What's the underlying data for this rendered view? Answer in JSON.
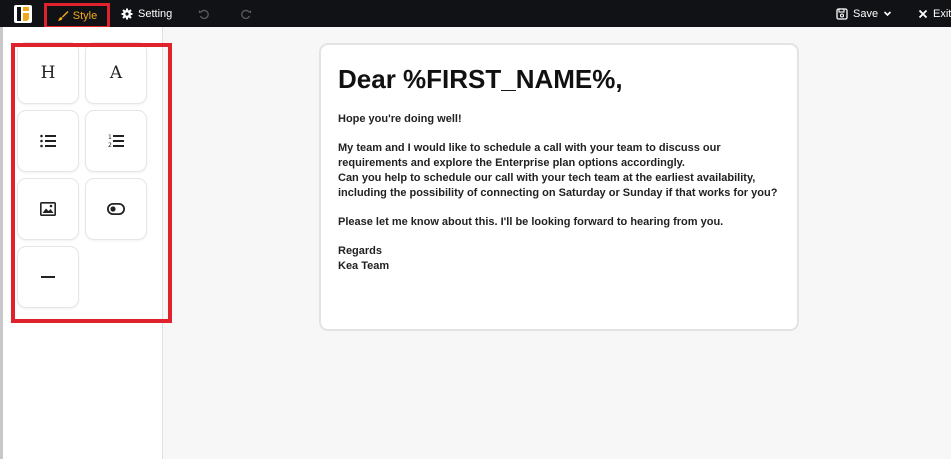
{
  "toolbar": {
    "style_label": "Style",
    "setting_label": "Setting",
    "save_label": "Save",
    "exit_label": "Exit",
    "icons": {
      "logo": "kea-logo-icon",
      "style": "brush-icon",
      "setting": "gear-icon",
      "undo": "undo-icon",
      "redo": "redo-icon",
      "save": "save-icon",
      "save_menu": "chevron-down-icon",
      "exit": "close-icon"
    }
  },
  "blocks": [
    {
      "name": "heading",
      "icon": "heading-icon",
      "glyph": "H"
    },
    {
      "name": "text",
      "icon": "text-icon",
      "glyph": "A"
    },
    {
      "name": "bulleted-list",
      "icon": "bulleted-list-icon"
    },
    {
      "name": "numbered-list",
      "icon": "numbered-list-icon"
    },
    {
      "name": "image",
      "icon": "image-icon"
    },
    {
      "name": "button",
      "icon": "toggle-button-icon"
    },
    {
      "name": "divider",
      "icon": "divider-icon"
    }
  ],
  "email": {
    "heading": "Dear %FIRST_NAME%,",
    "greeting": "Hope you're doing well!",
    "para1_line1": "My team and I would like to schedule a call with your team to discuss our requirements and explore the Enterprise plan options accordingly.",
    "para1_line2": "Can you help to schedule our call with your tech team at the earliest availability, including the possibility of connecting on Saturday or Sunday if that works for you?",
    "para2": "Please let me know about this. I'll be looking forward to hearing from you.",
    "signoff": "Regards",
    "signature": "Kea Team"
  },
  "colors": {
    "topbar_bg": "#111216",
    "accent": "#f2a81d",
    "highlight": "#e0222c",
    "canvas_bg": "#f7f7f7"
  }
}
